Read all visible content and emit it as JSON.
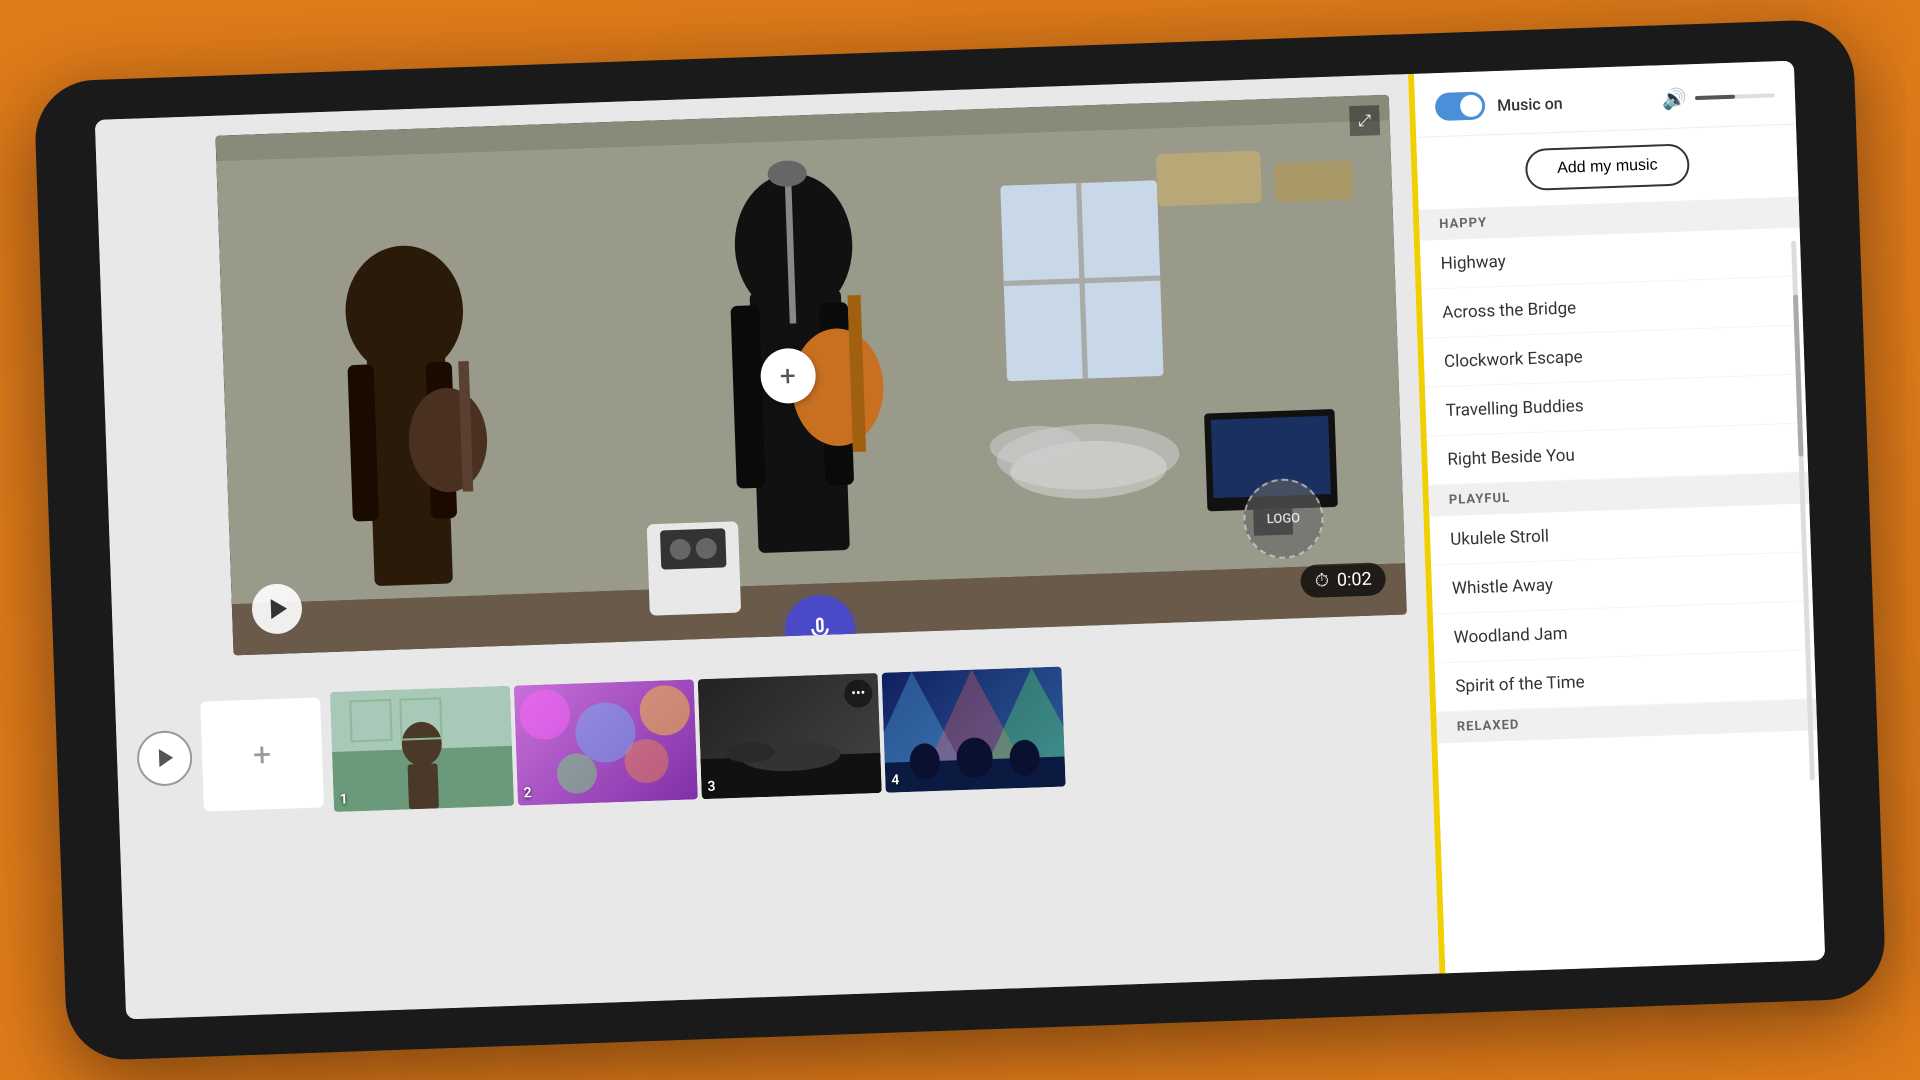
{
  "device": {
    "type": "tablet"
  },
  "header": {
    "music_on_label": "Music on",
    "add_music_button": "Add my music",
    "toggle_state": "on"
  },
  "video": {
    "timer": "0:02",
    "logo_label": "LOGO",
    "plus_label": "+"
  },
  "timeline": {
    "clips": [
      {
        "number": "1",
        "style": "clip-thumb-1"
      },
      {
        "number": "2",
        "style": "clip-thumb-2"
      },
      {
        "number": "3",
        "style": "clip-thumb-3"
      },
      {
        "number": "4",
        "style": "clip-thumb-4"
      }
    ]
  },
  "music": {
    "categories": [
      {
        "name": "HAPPY",
        "songs": [
          {
            "title": "Highway"
          },
          {
            "title": "Across the Bridge"
          },
          {
            "title": "Clockwork Escape"
          },
          {
            "title": "Travelling Buddies"
          },
          {
            "title": "Right Beside You"
          }
        ]
      },
      {
        "name": "PLAYFUL",
        "songs": [
          {
            "title": "Ukulele Stroll"
          },
          {
            "title": "Whistle Away"
          },
          {
            "title": "Woodland Jam"
          },
          {
            "title": "Spirit of the Time"
          }
        ]
      },
      {
        "name": "RELAXED",
        "songs": []
      }
    ]
  }
}
